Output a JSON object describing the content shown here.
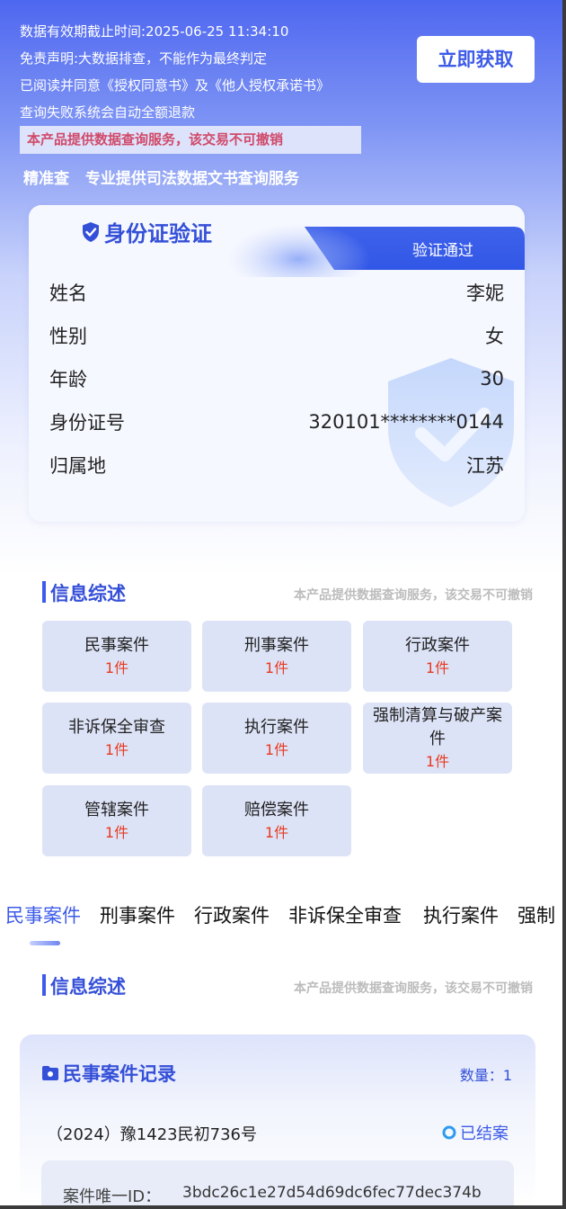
{
  "header": {
    "notices": [
      "数据有效期截止时间:2025-06-25 11:34:10",
      "免责声明:大数据排查，不能作为最终判定",
      "已阅读并同意《授权同意书》及《他人授权承诺书》",
      "查询失败系统会自动全额退款"
    ],
    "warning": "本产品提供数据查询服务，该交易不可撤销",
    "get_button": "立即获取",
    "tagline_a": "精准查",
    "tagline_b": "专业提供司法数据文书查询服务"
  },
  "id_card": {
    "title": "身份证验证",
    "status": "验证通过",
    "rows": [
      {
        "label": "姓名",
        "value": "李妮"
      },
      {
        "label": "性别",
        "value": "女"
      },
      {
        "label": "年龄",
        "value": "30"
      },
      {
        "label": "身份证号",
        "value": "320101********0144"
      },
      {
        "label": "归属地",
        "value": "江苏"
      }
    ]
  },
  "summary": {
    "title": "信息综述",
    "note": "本产品提供数据查询服务，该交易不可撤销",
    "tiles": [
      {
        "name": "民事案件",
        "count": "1件"
      },
      {
        "name": "刑事案件",
        "count": "1件"
      },
      {
        "name": "行政案件",
        "count": "1件"
      },
      {
        "name": "非诉保全审查",
        "count": "1件"
      },
      {
        "name": "执行案件",
        "count": "1件"
      },
      {
        "name": "强制清算与破产案件",
        "count": "1件"
      },
      {
        "name": "管辖案件",
        "count": "1件"
      },
      {
        "name": "赔偿案件",
        "count": "1件"
      }
    ]
  },
  "tabs": [
    "民事案件",
    "刑事案件",
    "行政案件",
    "非诉保全审查",
    "执行案件",
    "强制"
  ],
  "summary2": {
    "title": "信息综述",
    "note": "本产品提供数据查询服务，该交易不可撤销"
  },
  "record": {
    "title": "民事案件记录",
    "count": "数量：1",
    "case_no": "（2024）豫1423民初736号",
    "status": "已结案",
    "id_label": "案件唯一ID：",
    "id_value": "3bdc26c1e27d54d69dc6fec77dec374b"
  },
  "colors": {
    "primary": "#3d5be8",
    "count_red": "#e8391f",
    "warning_text": "#d04a6a"
  }
}
